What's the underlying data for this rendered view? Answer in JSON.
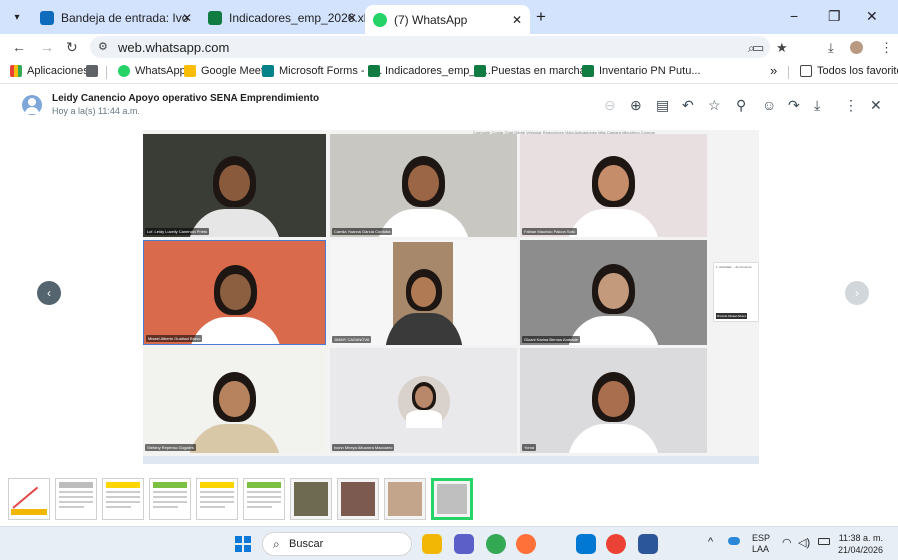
{
  "browser": {
    "tabs": [
      {
        "title": "Bandeja de entrada: Ivonn Mire",
        "icon": "outlook-icon",
        "color": "#0f6cbd",
        "active": false
      },
      {
        "title": "Indicadores_emp_2026.xlsx",
        "icon": "excel-icon",
        "color": "#107c41",
        "active": false
      },
      {
        "title": "(7) WhatsApp",
        "icon": "whatsapp-icon",
        "color": "#25d366",
        "active": true
      }
    ],
    "new_tab": "+",
    "window_controls": {
      "minimize": "−",
      "restore": "❐",
      "close": "✕"
    },
    "url": "web.whatsapp.com",
    "bookmarks": [
      {
        "label": "Aplicaciones",
        "color": "#ea4335"
      },
      {
        "label": "WhatsApp",
        "color": "#25d366"
      },
      {
        "label": "Google Meet",
        "color": "#fbbc04"
      },
      {
        "label": "Microsoft Forms - F...",
        "color": "#038387"
      },
      {
        "label": "Indicadores_emp_2...",
        "color": "#107c41"
      },
      {
        "label": "Puestas en marcha...",
        "color": "#107c41"
      },
      {
        "label": "Inventario PN Putu...",
        "color": "#107c41"
      }
    ],
    "bookmarks_overflow": "»",
    "all_bookmarks": "Todos los favoritos"
  },
  "viewer": {
    "sender": "Leidy Canencio Apoyo operativo SENA Emprendimiento",
    "time": "Hoy a la(s) 11:44 a.m.",
    "prev": "‹",
    "next": "›"
  },
  "screen": {
    "top_menu": "Compartir  Copiar   Chat  Gente  Vericular  Reacciones  Vista  Aplicaciones  Más  Cámara  Micrófono  Compar",
    "participants": [
      {
        "name": "Lcf. Leidy Lucelly Canencio Prieto",
        "bg": "#3a3d36",
        "skin": "#8a5a3c",
        "shirt": "#e6e6e6"
      },
      {
        "name": "Camila Yoanna García Cordoba",
        "bg": "#c8c7c2",
        "skin": "#9a6645",
        "shirt": "#ffffff"
      },
      {
        "name": "Fabian Mauricio Palcon Soto",
        "bg": "#e8dfe0",
        "skin": "#c58d6a",
        "shirt": "#ffffff"
      },
      {
        "name": "Misael Alberto Gualtuzi Bravo",
        "bg": "#d96a4c",
        "skin": "#8c5f40",
        "shirt": "#ffffff"
      },
      {
        "name": "JIMMY CASANOVA",
        "bg": "#f6f6f6",
        "skin": "#b07a55",
        "shirt": "#3a3a3a"
      },
      {
        "name": "Gloani Karina Bernos Andrade",
        "bg": "#8d8d8d",
        "skin": "#c49a7c",
        "shirt": "#ffffff"
      },
      {
        "name": "Stefany Repenso Gugales",
        "bg": "#f2f2ef",
        "skin": "#b7835e",
        "shirt": "#d8c8a8"
      },
      {
        "name": "Ivonn Mireya Altuzarra Maccaero",
        "bg": "#e9e9eb",
        "skin": "#b9876a",
        "shirt": "#ffffff"
      },
      {
        "name": "Yoma",
        "bg": "#dbdbdd",
        "skin": "#a86e4e",
        "shirt": "#ffffff"
      }
    ],
    "side_panel_title": "1. Actividad ... de Fomento",
    "side_panel_label": "Ricardo Misael Albero"
  },
  "thumbnails": [
    {
      "type": "chart",
      "color": "#e34a4a"
    },
    {
      "type": "table",
      "color": "#bdbdbd"
    },
    {
      "type": "doc",
      "color": "#ffd600"
    },
    {
      "type": "sheet",
      "color": "#7bc043"
    },
    {
      "type": "doc",
      "color": "#ffd600"
    },
    {
      "type": "doc",
      "color": "#7bc043"
    },
    {
      "type": "photo",
      "color": "#6e6a52"
    },
    {
      "type": "photo",
      "color": "#7d5a4f"
    },
    {
      "type": "photo",
      "color": "#c2a58a"
    },
    {
      "type": "photo",
      "color": "#bfbfbf"
    }
  ],
  "taskbar": {
    "search_label": "Buscar",
    "apps": [
      {
        "name": "file-explorer-icon",
        "color": "#f2b705"
      },
      {
        "name": "teams-icon",
        "color": "#5b5fc7"
      },
      {
        "name": "chrome-icon",
        "color": "#34a853"
      },
      {
        "name": "firefox-icon",
        "color": "#ff7139"
      },
      {
        "name": "paint-icon",
        "color": "#e8eef6"
      },
      {
        "name": "ms-store-icon",
        "color": "#0078d4"
      },
      {
        "name": "chrome-profile-icon",
        "color": "#ea4335"
      },
      {
        "name": "word-icon",
        "color": "#2b579a"
      }
    ],
    "tray_chevron": "^",
    "lang_top": "ESP",
    "lang_bottom": "LAA",
    "clock_time": "11:38 a. m.",
    "clock_date": "21/04/2026"
  }
}
